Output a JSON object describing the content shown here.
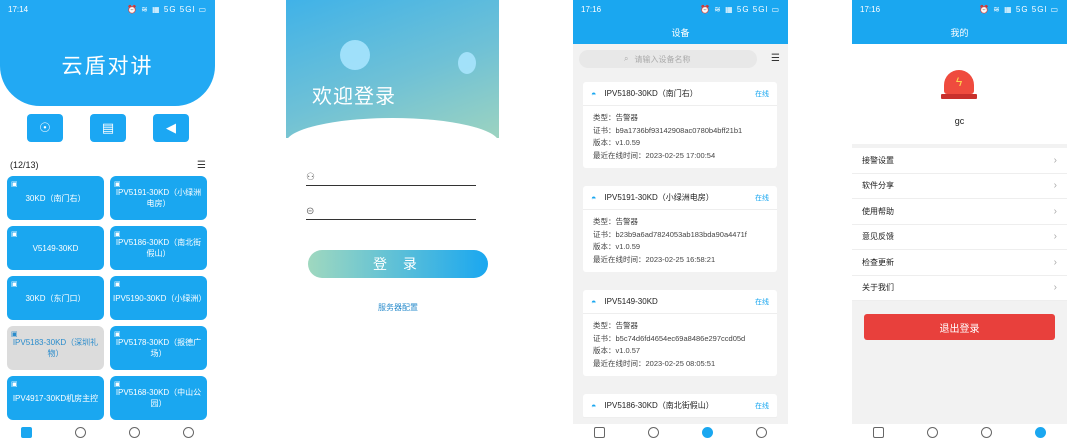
{
  "phone1": {
    "status_time": "17:14",
    "status_icons": "⏰ ≋ ▦ 5G 5Gl ▭",
    "title": "云盾对讲",
    "count": "(12/13)",
    "tiles": [
      {
        "label": "30KD（南门右）",
        "online": true
      },
      {
        "label": "IPV5191-30KD（小绿洲电房）",
        "online": true
      },
      {
        "label": "V5149-30KD",
        "online": true
      },
      {
        "label": "IPV5186-30KD（南北街假山）",
        "online": true
      },
      {
        "label": "30KD（东门口）",
        "online": true
      },
      {
        "label": "IPV5190-30KD（小绿洲）",
        "online": true
      },
      {
        "label": "IPV5183-30KD（深圳礼物）",
        "online": false
      },
      {
        "label": "IPV5178-30KD（报德广场）",
        "online": true
      },
      {
        "label": "IPV4917-30KD机房主控",
        "online": true
      },
      {
        "label": "IPV5168-30KD（中山公园）",
        "online": true
      }
    ]
  },
  "phone2": {
    "welcome": "欢迎登录",
    "username_placeholder": "",
    "password_placeholder": "",
    "login_label": "登 录",
    "server_config": "服务器配置"
  },
  "phone3": {
    "status_time": "17:16",
    "status_icons": "⏰ ≋ ▦ 5G 5Gl ▭",
    "title": "设备",
    "search_placeholder": "请输入设备名称",
    "devices": [
      {
        "name": "IPV5180-30KD（南门右）",
        "status": "在线",
        "type": "类型：告警器",
        "cert": "证书：b9a1736bf93142908ac0780b4bff21b1",
        "version": "版本：v1.0.59",
        "last_online": "最近在线时间：2023-02-25 17:00:54"
      },
      {
        "name": "IPV5191-30KD（小绿洲电房）",
        "status": "在线",
        "type": "类型：告警器",
        "cert": "证书：b23b9a6ad7824053ab183bda90a4471f",
        "version": "版本：v1.0.59",
        "last_online": "最近在线时间：2023-02-25 16:58:21"
      },
      {
        "name": "IPV5149-30KD",
        "status": "在线",
        "type": "类型：告警器",
        "cert": "证书：b5c74d6fd4654ec69a8486e297ccd05d",
        "version": "版本：v1.0.57",
        "last_online": "最近在线时间：2023-02-25 08:05:51"
      },
      {
        "name": "IPV5186-30KD（南北街假山）",
        "status": "在线"
      }
    ]
  },
  "phone4": {
    "status_time": "17:16",
    "status_icons": "⏰ ≋ ▦ 5G 5Gl ▭",
    "title": "我的",
    "username": "gc",
    "menu": [
      "接警设置",
      "软件分享",
      "使用帮助",
      "意见反馈",
      "检查更新",
      "关于我们"
    ],
    "logout": "退出登录"
  },
  "colors": {
    "primary": "#1aa7f0",
    "danger": "#e8403c",
    "offline": "#dcdcdc"
  }
}
